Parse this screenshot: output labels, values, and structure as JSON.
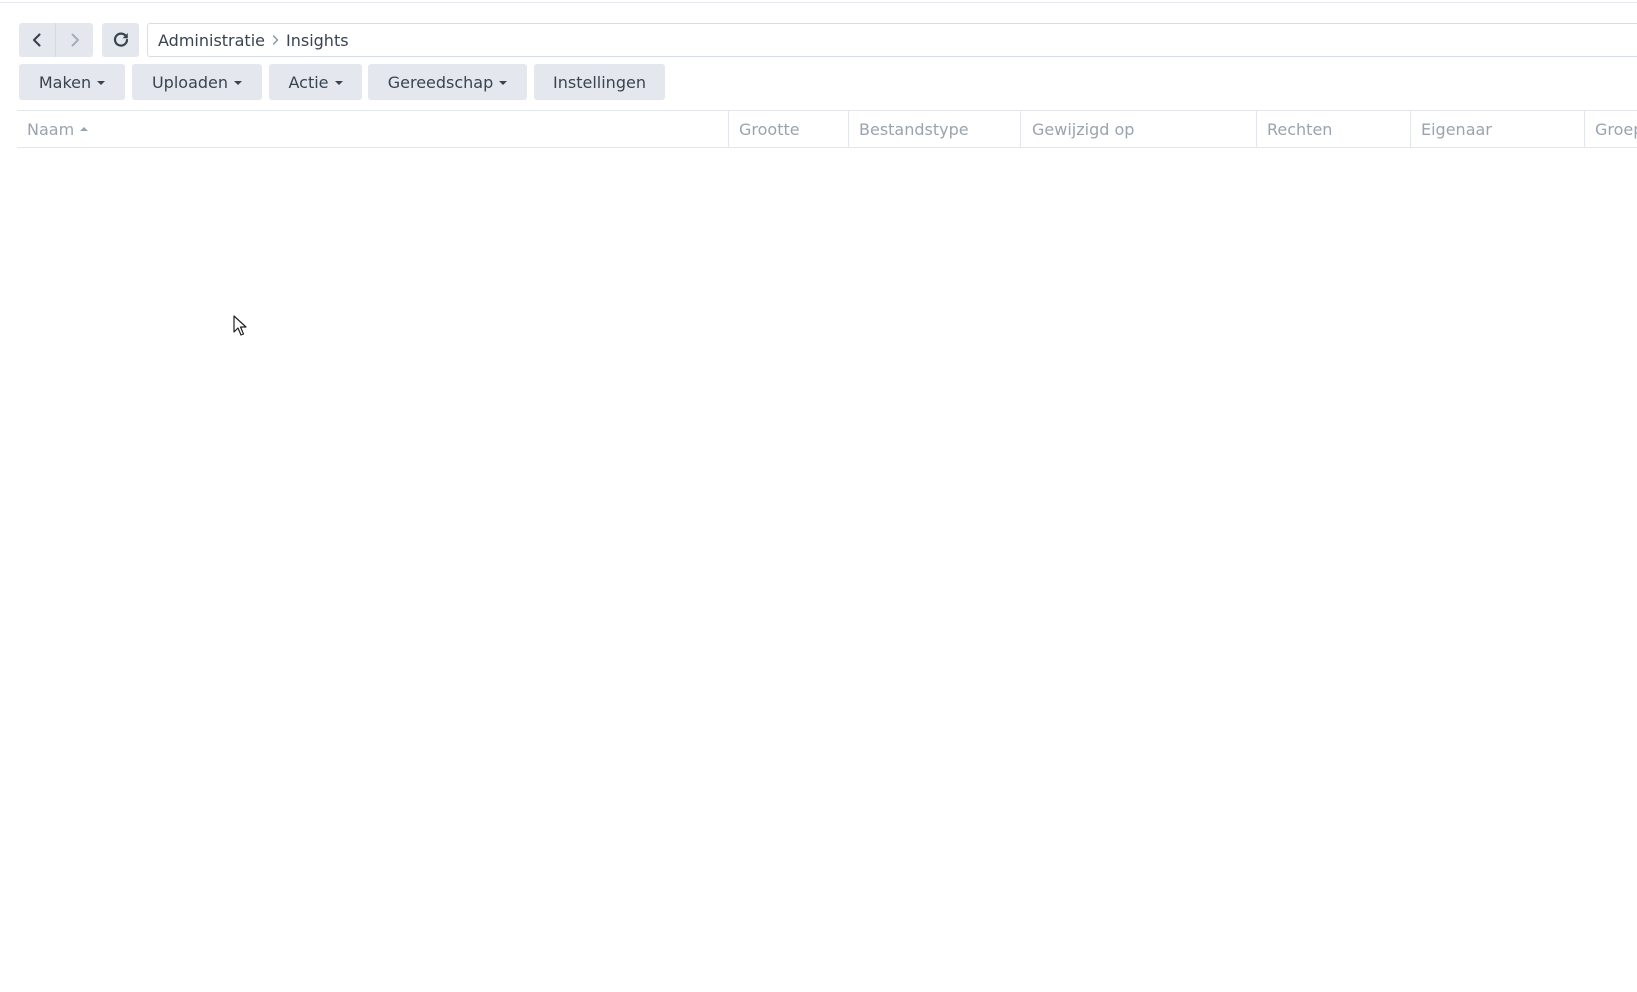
{
  "navigation": {
    "back_icon": "chevron-left-icon",
    "forward_icon": "chevron-right-icon",
    "refresh_icon": "refresh-icon"
  },
  "breadcrumb": {
    "items": [
      "Administratie",
      "Insights"
    ],
    "separator_icon": "chevron-right-icon"
  },
  "toolbar": {
    "create_label": "Maken",
    "upload_label": "Uploaden",
    "action_label": "Actie",
    "tools_label": "Gereedschap",
    "settings_label": "Instellingen"
  },
  "table": {
    "columns": [
      "Naam",
      "Grootte",
      "Bestandstype",
      "Gewijzigd op",
      "Rechten",
      "Eigenaar",
      "Groep"
    ],
    "sort_icon": "sort-ascending-icon"
  },
  "colors": {
    "button_bg": "#e4e8ee",
    "text": "#3a4350",
    "header_text": "#9aa3ae",
    "border": "#e3e7ec"
  }
}
